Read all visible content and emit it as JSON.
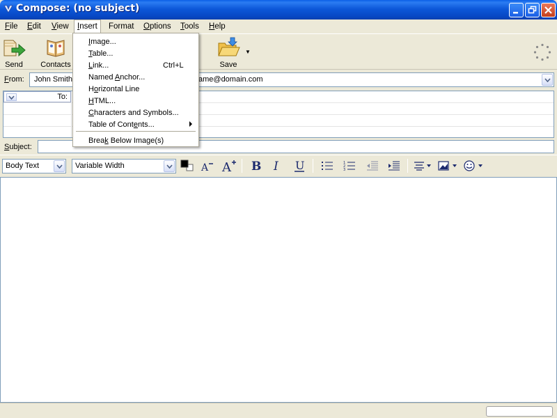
{
  "window": {
    "title": "Compose: (no subject)"
  },
  "menubar": {
    "items": [
      {
        "label": "File",
        "mnemonic": "F",
        "rest": "ile"
      },
      {
        "label": "Edit",
        "mnemonic": "E",
        "rest": "dit"
      },
      {
        "label": "View",
        "mnemonic": "V",
        "rest": "iew"
      },
      {
        "label": "Insert",
        "mnemonic": "I",
        "rest": "nsert"
      },
      {
        "label": "Format",
        "mnemonic": "F",
        "rest": "ormat",
        "pre": ""
      },
      {
        "label": "Options",
        "mnemonic": "O",
        "rest": "ptions"
      },
      {
        "label": "Tools",
        "mnemonic": "T",
        "rest": "ools"
      },
      {
        "label": "Help",
        "mnemonic": "H",
        "rest": "elp"
      }
    ]
  },
  "toolbar": {
    "send_label": "Send",
    "contacts_label": "Contacts",
    "save_label": "Save"
  },
  "address": {
    "from_label_pre": "F",
    "from_label_rest": "rom:",
    "from_value_name": "John Smith",
    "from_value_email": "ame@domain.com",
    "to_label": "To:"
  },
  "subject": {
    "label_pre": "S",
    "label_rest": "ubject:",
    "value": ""
  },
  "format_toolbar": {
    "paragraph_style": "Body Text",
    "font": "Variable Width",
    "text_color": "#000000"
  },
  "insert_menu": {
    "items": [
      {
        "pre": "",
        "mn": "I",
        "post": "mage...",
        "shortcut": "",
        "submenu": false
      },
      {
        "pre": "",
        "mn": "T",
        "post": "able...",
        "shortcut": "",
        "submenu": false
      },
      {
        "pre": "",
        "mn": "L",
        "post": "ink...",
        "shortcut": "Ctrl+L",
        "submenu": false
      },
      {
        "pre": "Named ",
        "mn": "A",
        "post": "nchor...",
        "shortcut": "",
        "submenu": false
      },
      {
        "pre": "H",
        "mn": "o",
        "post": "rizontal Line",
        "shortcut": "",
        "submenu": false
      },
      {
        "pre": "",
        "mn": "H",
        "post": "TML...",
        "shortcut": "",
        "submenu": false
      },
      {
        "pre": "",
        "mn": "C",
        "post": "haracters and Symbols...",
        "shortcut": "",
        "submenu": false
      },
      {
        "pre": "Table of Cont",
        "mn": "e",
        "post": "nts...",
        "shortcut": "",
        "submenu": true
      },
      {
        "pre": "Brea",
        "mn": "k",
        "post": " Below Image(s)",
        "shortcut": "",
        "submenu": false
      }
    ]
  }
}
